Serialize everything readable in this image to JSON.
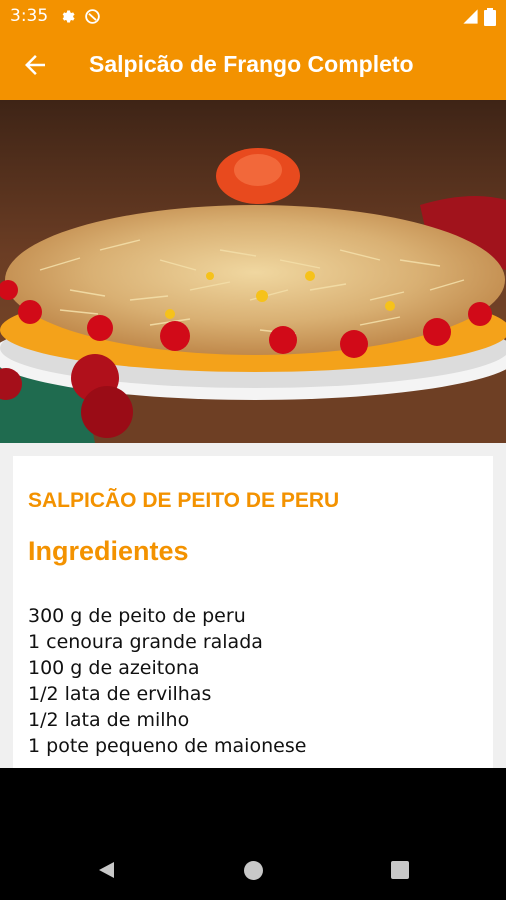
{
  "status": {
    "time": "3:35"
  },
  "app_bar": {
    "title": "Salpicão de Frango Completo"
  },
  "recipe": {
    "name": "SALPICÃO DE PEITO DE PERU",
    "section_heading": "Ingredientes",
    "ingredients": [
      "300 g de peito de peru",
      "1 cenoura grande ralada",
      "100 g de azeitona",
      "1/2 lata de ervilhas",
      "1/2 lata de milho",
      "1 pote pequeno de maionese"
    ]
  },
  "icons": {
    "back": "arrow-left-icon",
    "settings": "gear-icon",
    "dnd": "do-not-disturb-icon",
    "signal": "signal-icon",
    "battery": "battery-icon"
  },
  "colors": {
    "accent": "#f39200",
    "text": "#111111"
  }
}
